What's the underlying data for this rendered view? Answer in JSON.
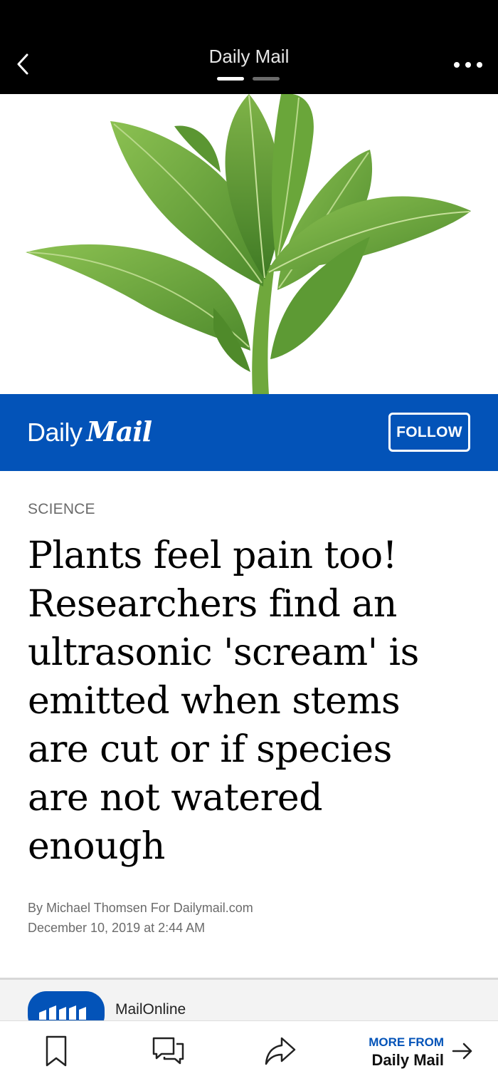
{
  "topbar": {
    "title": "Daily Mail",
    "back_icon": "chevron-left-icon",
    "more_icon": "more-horizontal-icon",
    "pager": {
      "pages": 2,
      "active": 1
    }
  },
  "hero": {
    "image_subject": "green leafy plant"
  },
  "publisher": {
    "logo_daily": "Daily",
    "logo_mail": "Mail",
    "follow_label": "FOLLOW",
    "brand_color": "#0353b8"
  },
  "article": {
    "category": "SCIENCE",
    "headline_lines": [
      "Plants feel pain too!",
      "Researchers find an",
      "ultrasonic 'scream' is",
      "emitted when stems",
      "are cut or if species",
      "are not watered",
      "enough"
    ],
    "byline": "By Michael Thomsen For Dailymail.com",
    "date": "December 10, 2019 at 2:44 AM"
  },
  "source": {
    "name": "MailOnline"
  },
  "toolbar": {
    "bookmark_icon": "bookmark-icon",
    "comment_icon": "comment-icon",
    "share_icon": "share-icon",
    "more_from_label": "MORE FROM",
    "more_from_publisher": "Daily Mail",
    "arrow_icon": "arrow-right-icon"
  }
}
